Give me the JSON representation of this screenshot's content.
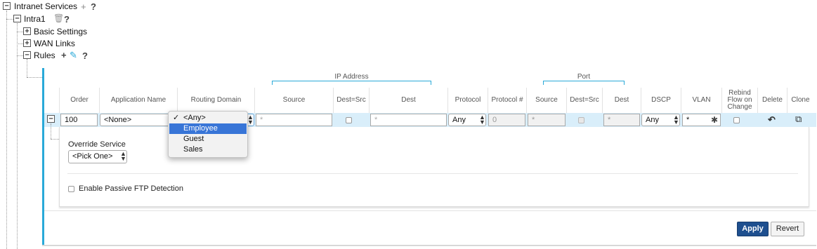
{
  "tree": {
    "intranet_services": "Intranet Services",
    "intra1": "Intra1",
    "basic_settings": "Basic Settings",
    "wan_links": "WAN Links",
    "rules": "Rules",
    "help": "?",
    "plus": "+",
    "expand": "+",
    "collapse": "−"
  },
  "groups": {
    "ip_address": "IP Address",
    "port": "Port"
  },
  "columns": {
    "order": "Order",
    "application_name": "Application Name",
    "routing_domain": "Routing Domain",
    "ip_source": "Source",
    "ip_dest_src": "Dest=Src",
    "ip_dest": "Dest",
    "protocol": "Protocol",
    "protocol_num": "Protocol #",
    "port_source": "Source",
    "port_dest_src": "Dest=Src",
    "port_dest": "Dest",
    "dscp": "DSCP",
    "vlan": "VLAN",
    "rebind": "Rebind Flow on Change",
    "delete": "Delete",
    "clone": "Clone"
  },
  "row": {
    "order": "100",
    "application_name": "<None>",
    "ip_source": "*",
    "ip_dest": "*",
    "protocol": "Any",
    "protocol_num": "0",
    "port_source": "*",
    "port_dest": "*",
    "dscp": "Any",
    "vlan": "*",
    "collapse": "−"
  },
  "routing_domain_dropdown": {
    "options": [
      "<Any>",
      "Employee",
      "Guest",
      "Sales"
    ],
    "checked": "<Any>",
    "highlighted": "Employee",
    "checkmark": "✓"
  },
  "details": {
    "override_service_label": "Override Service",
    "override_service_value": "<Pick One>",
    "passive_ftp_label": "Enable Passive FTP Detection"
  },
  "actions": {
    "apply": "Apply",
    "revert": "Revert"
  },
  "icons": {
    "trash": "🗑",
    "pencil": "✎",
    "undo": "↶",
    "clone": "⧉",
    "asterisk": "✱",
    "updown": "▲▼"
  },
  "colors": {
    "accent": "#29a9d8",
    "apply_bg": "#1e4f8f",
    "row_highlight": "#d9eefa",
    "menu_highlight": "#3875d7"
  }
}
